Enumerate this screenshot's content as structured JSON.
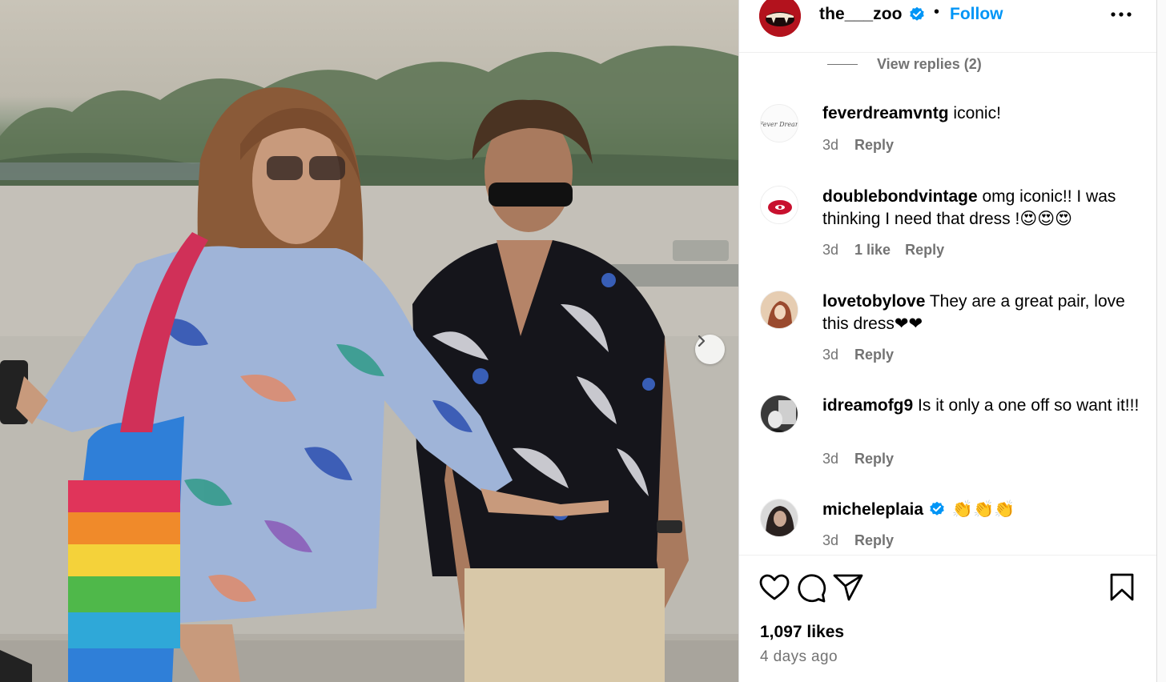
{
  "post": {
    "author": "the___zoo",
    "follow_label": "Follow",
    "separator": "•",
    "view_replies_label": "View replies (2)",
    "likes_label": "1,097 likes",
    "age_label": "4 days ago"
  },
  "comments": [
    {
      "user": "feverdreamvntg",
      "text": " iconic!",
      "time": "3d",
      "likes": "",
      "reply": "Reply",
      "verified": false
    },
    {
      "user": "doublebondvintage",
      "text": " omg iconic!! I was thinking I need that dress !😍😍😍",
      "time": "3d",
      "likes": "1 like",
      "reply": "Reply",
      "verified": false
    },
    {
      "user": "lovetobylove",
      "text": " They are a great pair, love this dress❤❤",
      "time": "3d",
      "likes": "",
      "reply": "Reply",
      "verified": false
    },
    {
      "user": "idreamofg9",
      "text": " Is it only a one off so want it!!!",
      "time": "3d",
      "likes": "",
      "reply": "Reply",
      "verified": false
    },
    {
      "user": "micheleplaia",
      "text": " 👏👏👏",
      "time": "3d",
      "likes": "",
      "reply": "Reply",
      "verified": true
    }
  ],
  "avatars": {
    "feverdream_text": "Fever Dream"
  },
  "icons": {
    "more": "more-options-icon",
    "verified": "verified-badge-icon",
    "next": "chevron-right-icon",
    "like": "heart-icon",
    "comment": "comment-bubble-icon",
    "share": "paper-plane-icon",
    "save": "bookmark-icon"
  },
  "colors": {
    "accent": "#0095f6",
    "muted_text": "#737373",
    "verified": "#0095f6"
  }
}
